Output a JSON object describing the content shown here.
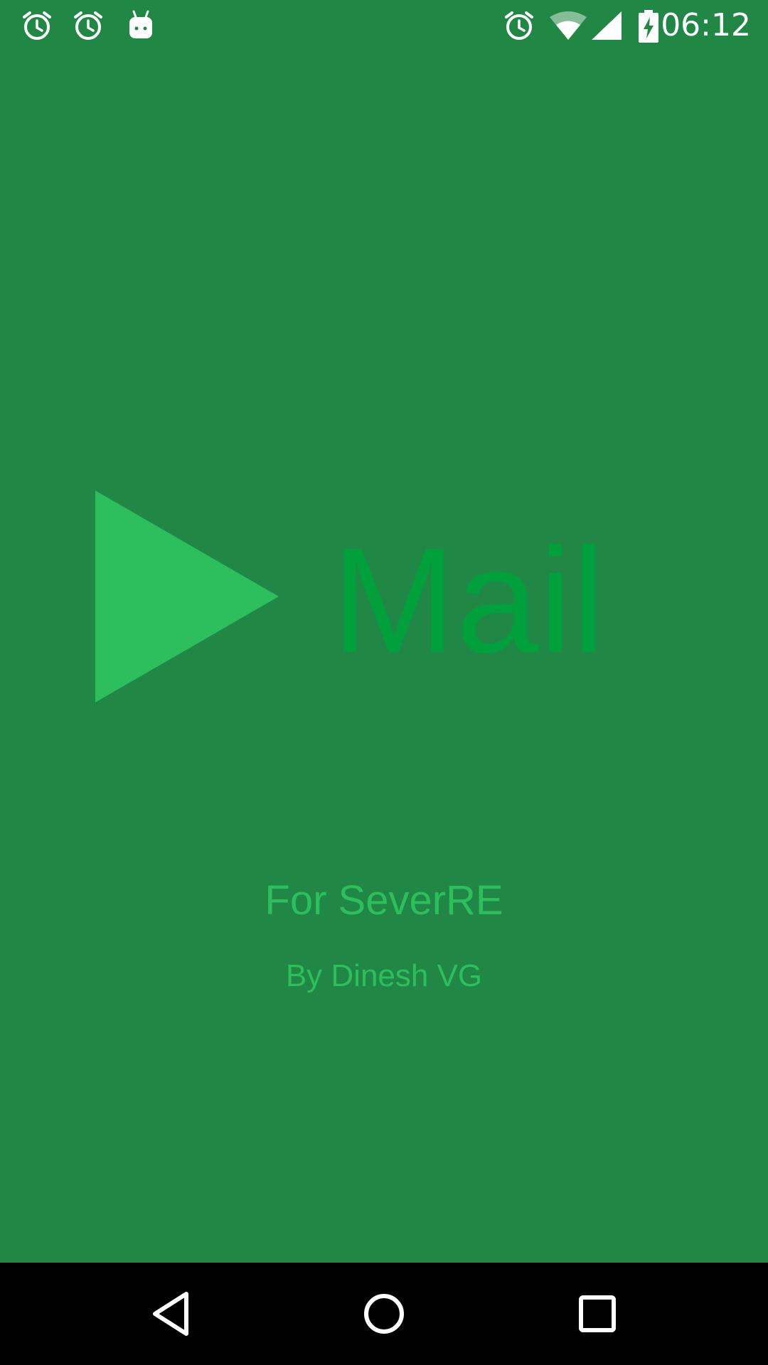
{
  "status_bar": {
    "time": "06:12",
    "left_icons": [
      "alarm-icon",
      "alarm-icon",
      "android-debug-icon"
    ],
    "right_icons": [
      "alarm-icon",
      "wifi-icon",
      "cell-signal-icon",
      "battery-charging-icon"
    ]
  },
  "splash": {
    "app_name": "Mail",
    "subtitle": "For SeverRE",
    "author": "By Dinesh VG",
    "colors": {
      "background": "#218745",
      "logo": "#2DBE5E",
      "app_name": "#00A03C",
      "text": "#2DBE5E"
    }
  },
  "nav_bar": {
    "buttons": [
      "back-icon",
      "home-icon",
      "recents-icon"
    ]
  }
}
